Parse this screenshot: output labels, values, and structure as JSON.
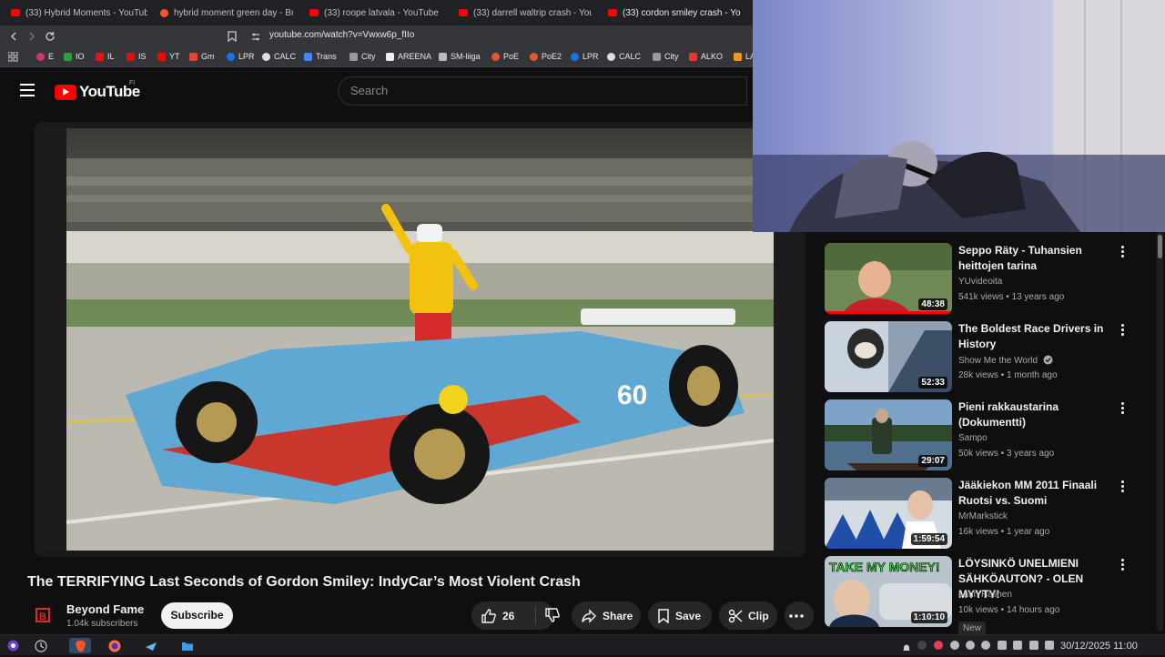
{
  "browser": {
    "tabs": [
      {
        "title": "(33) Hybrid Moments - YouTube",
        "icon": "youtube-icon"
      },
      {
        "title": "hybrid moment green day - Bra",
        "icon": "brave-search-icon"
      },
      {
        "title": "(33) roope latvala - YouTube",
        "icon": "youtube-icon"
      },
      {
        "title": "(33) darrell waltrip crash - YouTu",
        "icon": "youtube-icon"
      },
      {
        "title": "(33) cordon smiley crash - YouTu",
        "icon": "youtube-icon"
      }
    ],
    "url": "youtube.com/watch?v=Vwxw6p_fIIo",
    "bookmarks": [
      "E",
      "IO",
      "IL",
      "IS",
      "YT",
      "Gm",
      "LPR",
      "CALC",
      "Trans",
      "City",
      "AREENA",
      "SM-liiga",
      "PoE",
      "PoE2",
      "LPR",
      "CALC",
      "City",
      "ALKO",
      "LA"
    ]
  },
  "youtube": {
    "logo_text": "YouTube",
    "country_code": "FI",
    "search_placeholder": "Search"
  },
  "video": {
    "title": "The TERRIFYING Last Seconds of Gordon Smiley: IndyCar’s Most Violent Crash",
    "channel": "Beyond Fame",
    "subscribers": "1.04k subscribers",
    "subscribe_label": "Subscribe",
    "likes": "26",
    "share_label": "Share",
    "save_label": "Save",
    "clip_label": "Clip"
  },
  "recommendations": [
    {
      "title": "Seppo Räty - Tuhansien heittojen tarina",
      "channel": "YUvideoita",
      "meta": "541k views • 13 years ago",
      "duration": "48:38",
      "verified": false
    },
    {
      "title": "The Boldest Race Drivers in History",
      "channel": "Show Me the World",
      "meta": "28k views • 1 month ago",
      "duration": "52:33",
      "verified": true
    },
    {
      "title": "Pieni rakkaustarina (Dokumentti)",
      "channel": "Sampo",
      "meta": "50k views • 3 years ago",
      "duration": "29:07",
      "verified": false
    },
    {
      "title": "Jääkiekon MM 2011 Finaali Ruotsi vs. Suomi",
      "channel": "MrMarkstick",
      "meta": "16k views • 1 year ago",
      "duration": "1:59:54",
      "verified": false
    },
    {
      "title": "LÖYSINKÖ UNELMIENI SÄHKÖAUTON? - OLEN MYYTY!",
      "channel": "Lauri Halinen",
      "meta": "10k views • 14 hours ago",
      "duration": "1:10:10",
      "verified": false,
      "badge": "New",
      "thumb_text": "TAKE MY MONEY!"
    }
  ],
  "taskbar": {
    "clock": "30/12/2025 11:00"
  },
  "colors": {
    "yt_red": "#ff0000",
    "background": "#0f0f0f",
    "car_blue": "#5fa8d3"
  }
}
